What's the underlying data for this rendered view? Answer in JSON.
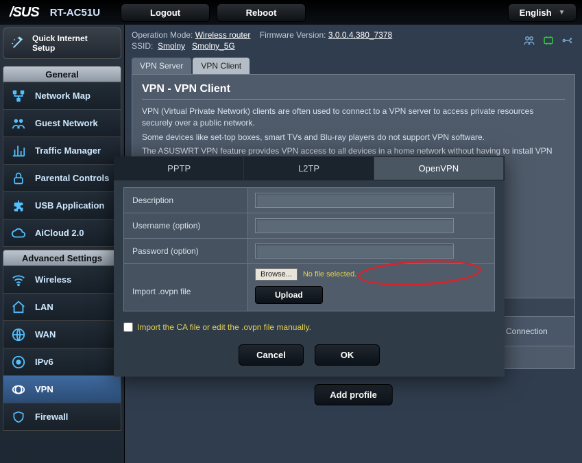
{
  "top": {
    "brand": "/SUS",
    "model": "RT-AC51U",
    "logout": "Logout",
    "reboot": "Reboot",
    "language": "English"
  },
  "header": {
    "operation_mode_label": "Operation Mode:",
    "operation_mode": "Wireless router",
    "fw_label": "Firmware Version:",
    "fw_version": "3.0.0.4.380_7378",
    "ssid_label": "SSID:",
    "ssid1": "Smolny",
    "ssid2": "Smolny_5G"
  },
  "sidebar": {
    "qis_line1": "Quick Internet",
    "qis_line2": "Setup",
    "general_head": "General",
    "general": [
      {
        "label": "Network Map"
      },
      {
        "label": "Guest Network"
      },
      {
        "label": "Traffic Manager"
      },
      {
        "label": "Parental Controls"
      },
      {
        "label": "USB Application"
      },
      {
        "label": "AiCloud 2.0"
      }
    ],
    "adv_head": "Advanced Settings",
    "advanced": [
      {
        "label": "Wireless"
      },
      {
        "label": "LAN"
      },
      {
        "label": "WAN"
      },
      {
        "label": "IPv6"
      },
      {
        "label": "VPN"
      },
      {
        "label": "Firewall"
      }
    ]
  },
  "tabs": {
    "server": "VPN Server",
    "client": "VPN Client"
  },
  "panel": {
    "title": "VPN - VPN Client",
    "desc1": "VPN (Virtual Private Network) clients are often used to connect to a VPN server to access private resources securely over a public network.",
    "desc2": "Some devices like set-top boxes, smart TVs and Blu-ray players do not support VPN software.",
    "desc3": "The ASUSWRT VPN feature provides VPN access to all devices in a home network without having to install VPN software on each device.",
    "connection": "Connection",
    "add_profile": "Add profile"
  },
  "modal": {
    "proto": {
      "pptp": "PPTP",
      "l2tp": "L2TP",
      "openvpn": "OpenVPN"
    },
    "labels": {
      "description": "Description",
      "username": "Username (option)",
      "password": "Password (option)",
      "import": "Import .ovpn file"
    },
    "browse": "Browse...",
    "no_file": "No file selected.",
    "upload": "Upload",
    "import_ca": "Import the CA file or edit the .ovpn file manually.",
    "cancel": "Cancel",
    "ok": "OK"
  }
}
